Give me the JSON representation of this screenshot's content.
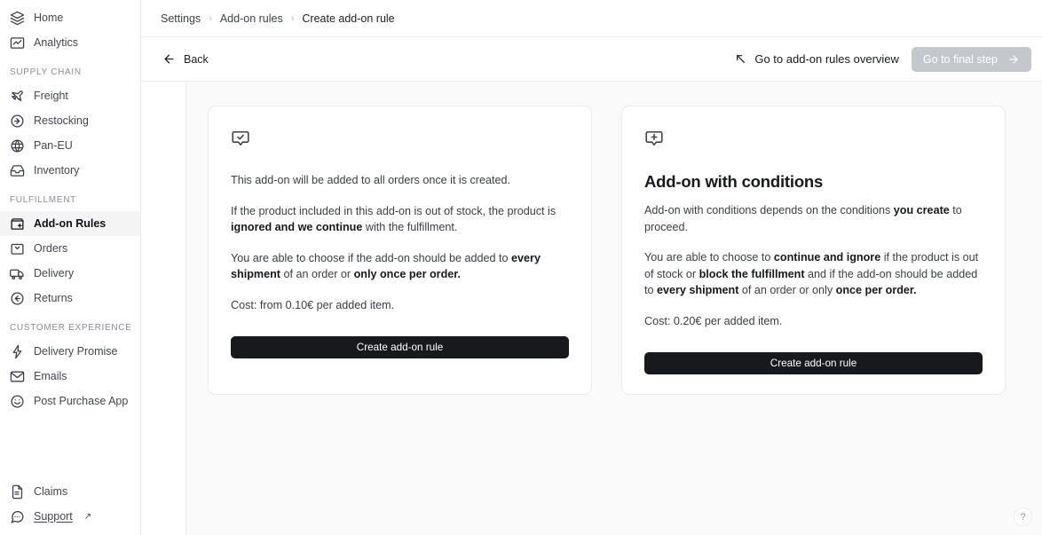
{
  "sidebar": {
    "top_items": [
      {
        "label": "Home",
        "icon": "layers-icon",
        "active": false
      },
      {
        "label": "Analytics",
        "icon": "analytics-chart-icon",
        "active": false
      }
    ],
    "sections": [
      {
        "title": "SUPPLY CHAIN",
        "items": [
          {
            "label": "Freight",
            "icon": "plane-icon",
            "active": false
          },
          {
            "label": "Restocking",
            "icon": "arrow-right-circle-icon",
            "active": false
          },
          {
            "label": "Pan-EU",
            "icon": "globe-icon",
            "active": false
          },
          {
            "label": "Inventory",
            "icon": "inbox-icon",
            "active": false
          }
        ]
      },
      {
        "title": "FULFILLMENT",
        "items": [
          {
            "label": "Add-on Rules",
            "icon": "box-plus-icon",
            "active": true
          },
          {
            "label": "Orders",
            "icon": "bag-check-icon",
            "active": false
          },
          {
            "label": "Delivery",
            "icon": "truck-icon",
            "active": false
          },
          {
            "label": "Returns",
            "icon": "arrow-left-circle-icon",
            "active": false
          }
        ]
      },
      {
        "title": "CUSTOMER EXPERIENCE",
        "items": [
          {
            "label": "Delivery Promise",
            "icon": "lightning-icon",
            "active": false
          },
          {
            "label": "Emails",
            "icon": "envelope-icon",
            "active": false
          },
          {
            "label": "Post Purchase App",
            "icon": "smiley-icon",
            "active": false
          }
        ]
      }
    ],
    "bottom_items": [
      {
        "label": "Claims",
        "icon": "document-icon",
        "external": false
      },
      {
        "label": "Support",
        "icon": "chat-bubble-icon",
        "external": true,
        "external_glyph": "↗"
      }
    ]
  },
  "breadcrumb": {
    "items": [
      "Settings",
      "Add-on rules",
      "Create add-on rule"
    ],
    "separator": "›"
  },
  "toolbar": {
    "back_label": "Back",
    "back_icon": "arrow-left-icon",
    "overview_label": "Go to add-on rules overview",
    "overview_icon": "arrow-up-left-icon",
    "final_step_label": "Go to final step",
    "final_step_icon": "arrow-right-icon",
    "final_step_disabled": true
  },
  "status_badge": {
    "icon": "eye-off-icon",
    "bg_color": "#d6f7e8",
    "icon_color": "#18a878"
  },
  "cards": [
    {
      "icon": "message-check-icon",
      "title": "",
      "paragraphs": [
        {
          "segments": [
            {
              "text": "This add-on will be added to all orders once it is created.",
              "bold": false
            }
          ]
        },
        {
          "segments": [
            {
              "text": "If the product included in this add-on is out of stock, the product is ",
              "bold": false
            },
            {
              "text": "ignored and we continue",
              "bold": true
            },
            {
              "text": " with the fulfillment.",
              "bold": false
            }
          ]
        },
        {
          "segments": [
            {
              "text": "You are able to choose if the add-on should be added to ",
              "bold": false
            },
            {
              "text": "every shipment",
              "bold": true
            },
            {
              "text": " of an order or ",
              "bold": false
            },
            {
              "text": "only once per order.",
              "bold": true
            }
          ]
        }
      ],
      "cost": "Cost: from 0.10€ per added item.",
      "button_label": "Create add-on rule"
    },
    {
      "icon": "message-plus-icon",
      "title": "Add-on with conditions",
      "paragraphs": [
        {
          "segments": [
            {
              "text": "Add-on with conditions depends on the conditions ",
              "bold": false
            },
            {
              "text": "you create",
              "bold": true
            },
            {
              "text": " to proceed.",
              "bold": false
            }
          ]
        },
        {
          "segments": [
            {
              "text": "You are able to choose to ",
              "bold": false
            },
            {
              "text": "continue and ignore",
              "bold": true
            },
            {
              "text": " if the product is out of stock or ",
              "bold": false
            },
            {
              "text": "block the fulfillment",
              "bold": true
            },
            {
              "text": " and if the add-on should be added to ",
              "bold": false
            },
            {
              "text": "every shipment",
              "bold": true
            },
            {
              "text": " of an order or only ",
              "bold": false
            },
            {
              "text": "once per order.",
              "bold": true
            }
          ]
        }
      ],
      "cost": "Cost: 0.20€ per added item.",
      "button_label": "Create add-on rule"
    }
  ],
  "help": {
    "glyph": "?"
  }
}
